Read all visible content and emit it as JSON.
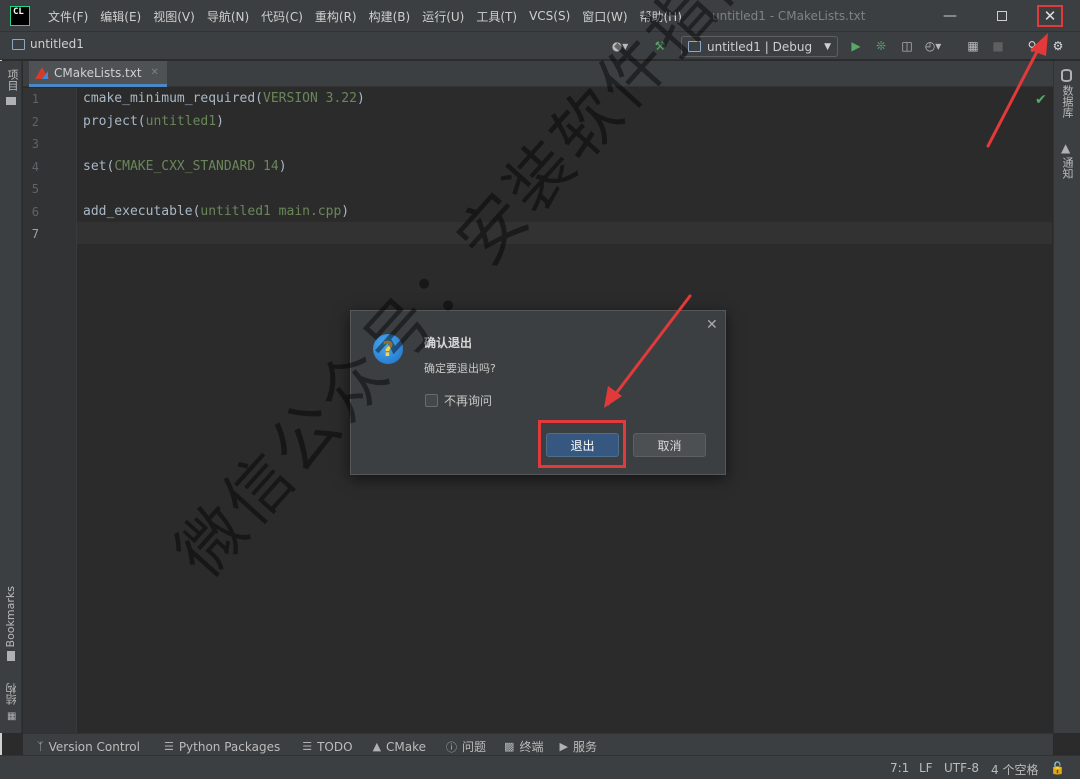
{
  "app": {
    "logo_text": "CL",
    "window_title": "untitled1 - CMakeLists.txt"
  },
  "menu": [
    "文件(F)",
    "编辑(E)",
    "视图(V)",
    "导航(N)",
    "代码(C)",
    "重构(R)",
    "构建(B)",
    "运行(U)",
    "工具(T)",
    "VCS(S)",
    "窗口(W)",
    "帮助(H)"
  ],
  "navbar": {
    "project_name": "untitled1",
    "run_config": "untitled1 | Debug"
  },
  "left_strip": {
    "project_label": "项目",
    "bookmarks_label": "Bookmarks",
    "structure_label": "结构"
  },
  "right_strip": {
    "database_label": "数据库",
    "notifications_label": "通知"
  },
  "tab": {
    "filename": "CMakeLists.txt"
  },
  "editor": {
    "line_numbers": [
      "1",
      "2",
      "3",
      "4",
      "5",
      "6",
      "7"
    ],
    "lines": [
      {
        "fn": "cmake_minimum_required(",
        "arg": "VERSION 3.22",
        "close": ")"
      },
      {
        "fn": "project(",
        "arg": "untitled1",
        "close": ")"
      },
      {
        "fn": "",
        "arg": "",
        "close": ""
      },
      {
        "fn": "set(",
        "arg": "CMAKE_CXX_STANDARD 14",
        "close": ")"
      },
      {
        "fn": "",
        "arg": "",
        "close": ""
      },
      {
        "fn": "add_executable(",
        "arg": "untitled1 main.cpp",
        "close": ")"
      },
      {
        "fn": "",
        "arg": "",
        "close": ""
      }
    ]
  },
  "dialog": {
    "title": "确认退出",
    "message": "确定要退出吗?",
    "checkbox_label": "不再询问",
    "primary_button": "退出",
    "secondary_button": "取消"
  },
  "bottom_tools": [
    "Version Control",
    "Python Packages",
    "TODO",
    "CMake",
    "问题",
    "终端",
    "服务"
  ],
  "status": {
    "position": "7:1",
    "line_separator": "LF",
    "encoding": "UTF-8",
    "indent": "4 个空格"
  },
  "watermark": "微信公众号：安装软件指南",
  "colors": {
    "accent": "#4a88c7",
    "annotation_red": "#e23a3a",
    "primary_button": "#365880"
  }
}
